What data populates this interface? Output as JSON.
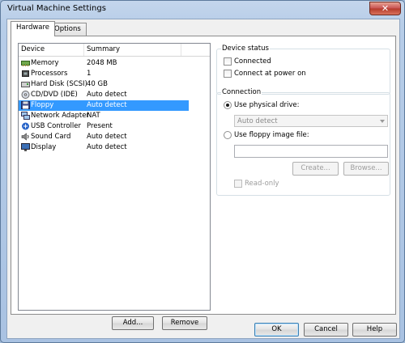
{
  "window": {
    "title": "Virtual Machine Settings",
    "close_glyph": "✕"
  },
  "tabs": [
    {
      "label": "Hardware",
      "active": true
    },
    {
      "label": "Options",
      "active": false
    }
  ],
  "device_list": {
    "headers": {
      "device": "Device",
      "summary": "Summary"
    },
    "items": [
      {
        "device": "Memory",
        "summary": "2048 MB",
        "icon": "memory-icon"
      },
      {
        "device": "Processors",
        "summary": "1",
        "icon": "processor-icon"
      },
      {
        "device": "Hard Disk (SCSI)",
        "summary": "40 GB",
        "icon": "hard-disk-icon"
      },
      {
        "device": "CD/DVD (IDE)",
        "summary": "Auto detect",
        "icon": "cd-dvd-icon"
      },
      {
        "device": "Floppy",
        "summary": "Auto detect",
        "icon": "floppy-icon",
        "selected": true
      },
      {
        "device": "Network Adapter",
        "summary": "NAT",
        "icon": "network-adapter-icon"
      },
      {
        "device": "USB Controller",
        "summary": "Present",
        "icon": "usb-controller-icon"
      },
      {
        "device": "Sound Card",
        "summary": "Auto detect",
        "icon": "sound-card-icon"
      },
      {
        "device": "Display",
        "summary": "Auto detect",
        "icon": "display-icon"
      }
    ],
    "add_label": "Add...",
    "remove_label": "Remove"
  },
  "device_status": {
    "title": "Device status",
    "connected_label": "Connected",
    "connected_checked": false,
    "connect_power_on_label": "Connect at power on",
    "connect_power_on_checked": false
  },
  "connection": {
    "title": "Connection",
    "use_physical_label": "Use physical drive:",
    "use_physical_selected": true,
    "physical_drive_value": "Auto detect",
    "use_image_label": "Use floppy image file:",
    "use_image_selected": false,
    "image_file_value": "",
    "create_label": "Create...",
    "browse_label": "Browse...",
    "read_only_label": "Read-only",
    "read_only_checked": false
  },
  "footer": {
    "ok_label": "OK",
    "cancel_label": "Cancel",
    "help_label": "Help"
  },
  "colors": {
    "selection": "#3399ff",
    "titlebar": "#b7cde8",
    "close_button": "#c75050"
  }
}
